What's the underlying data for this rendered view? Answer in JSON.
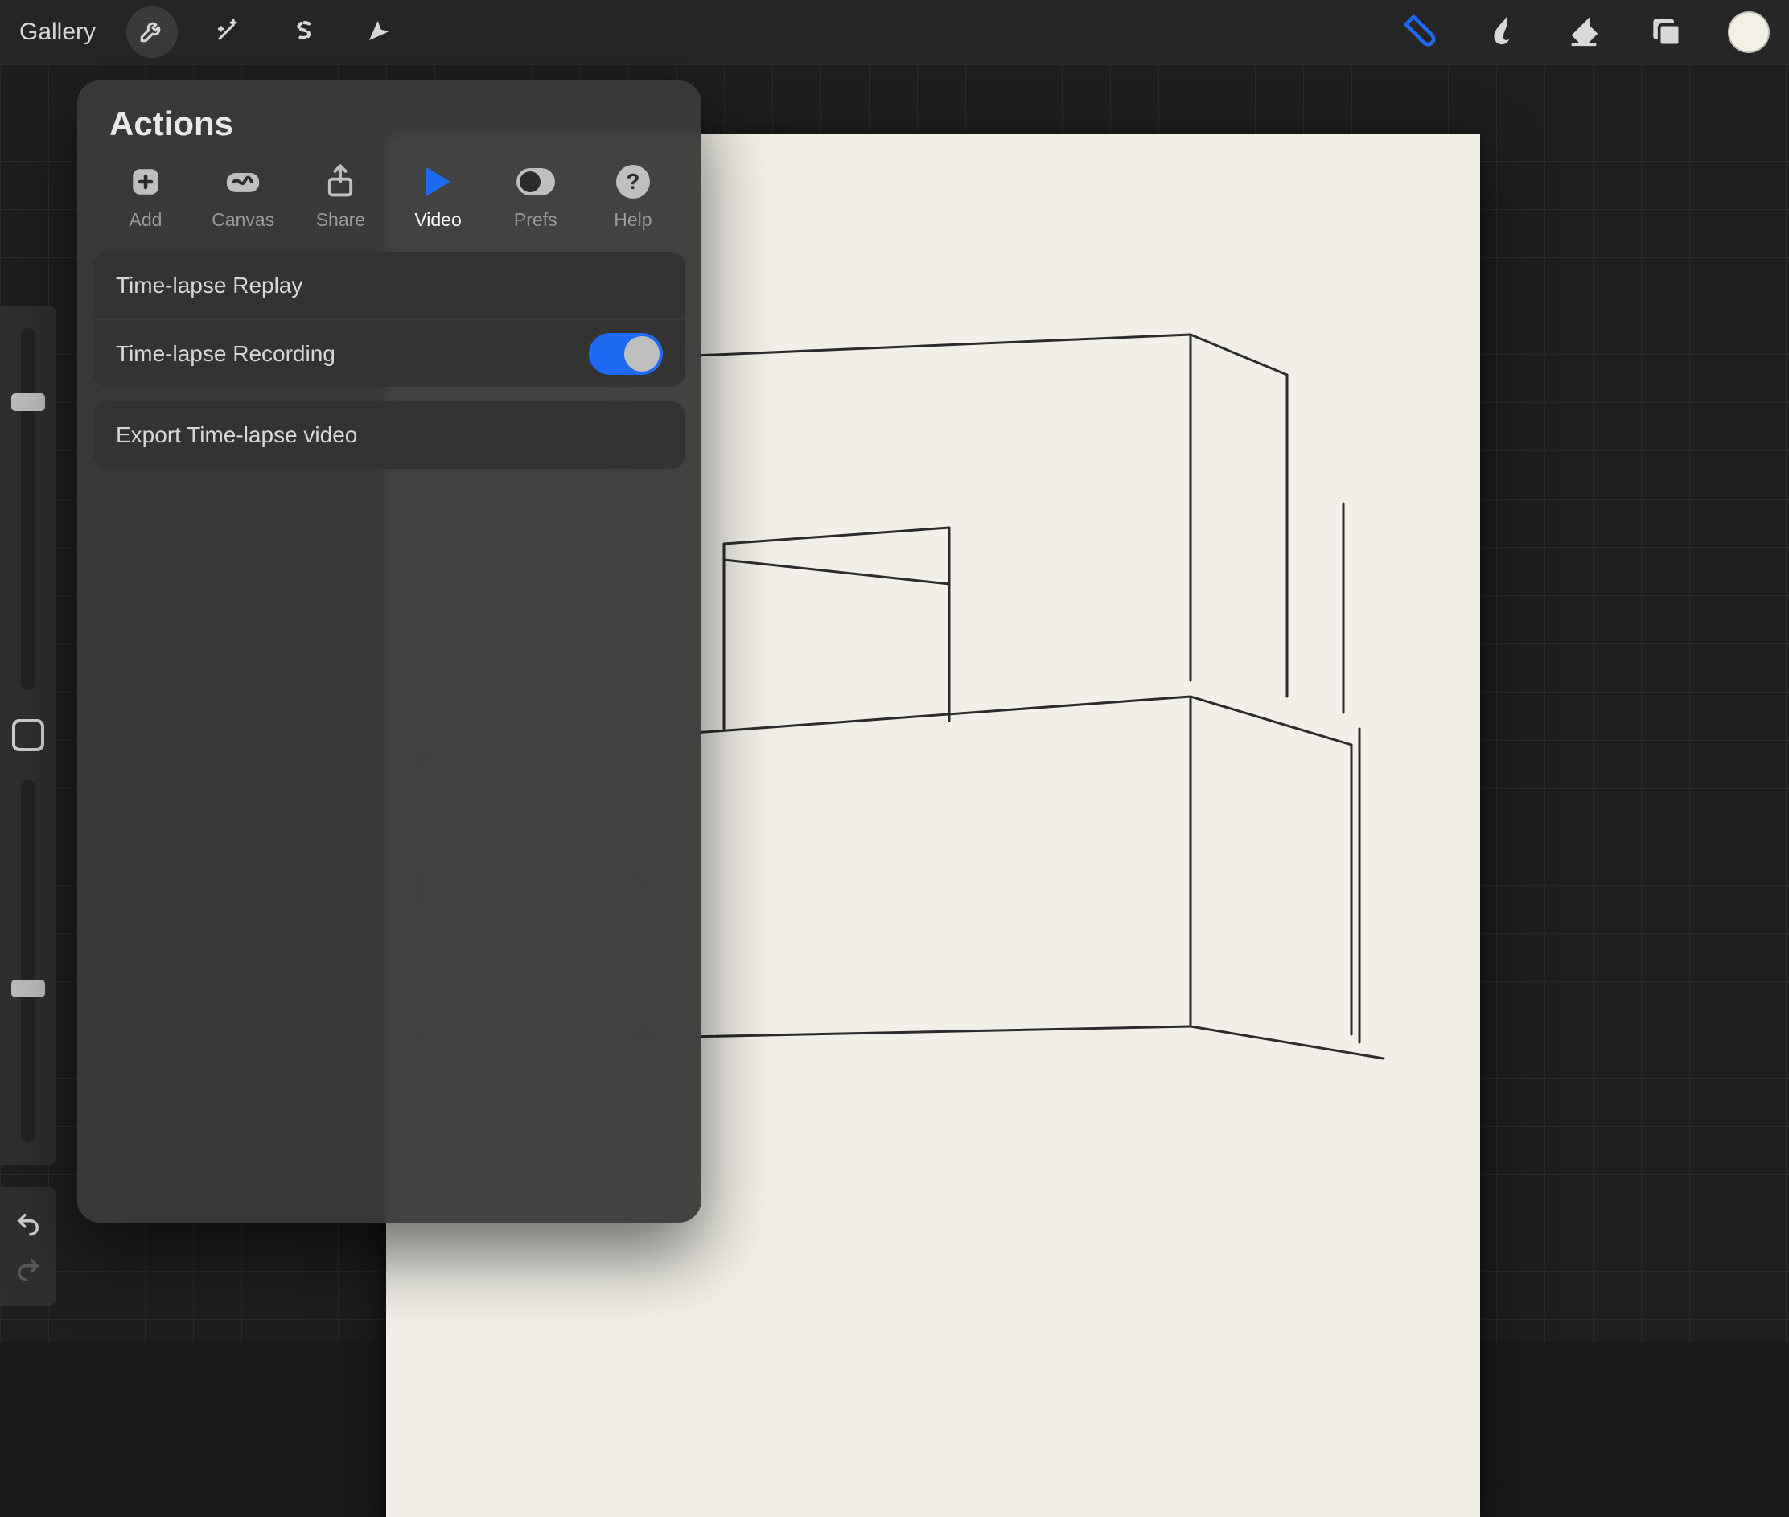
{
  "topbar": {
    "gallery_label": "Gallery"
  },
  "side": {
    "brush_slider_pos_pct": 18,
    "opacity_slider_pos_pct": 55
  },
  "actions": {
    "title": "Actions",
    "tabs": {
      "add": "Add",
      "canvas": "Canvas",
      "share": "Share",
      "video": "Video",
      "prefs": "Prefs",
      "help": "Help"
    },
    "active_tab": "video",
    "video": {
      "replay_label": "Time-lapse Replay",
      "recording_label": "Time-lapse Recording",
      "recording_on": true,
      "export_label": "Export Time-lapse video"
    }
  },
  "colors": {
    "accent": "#1f6af2",
    "swatch": "#f3f1e6"
  }
}
